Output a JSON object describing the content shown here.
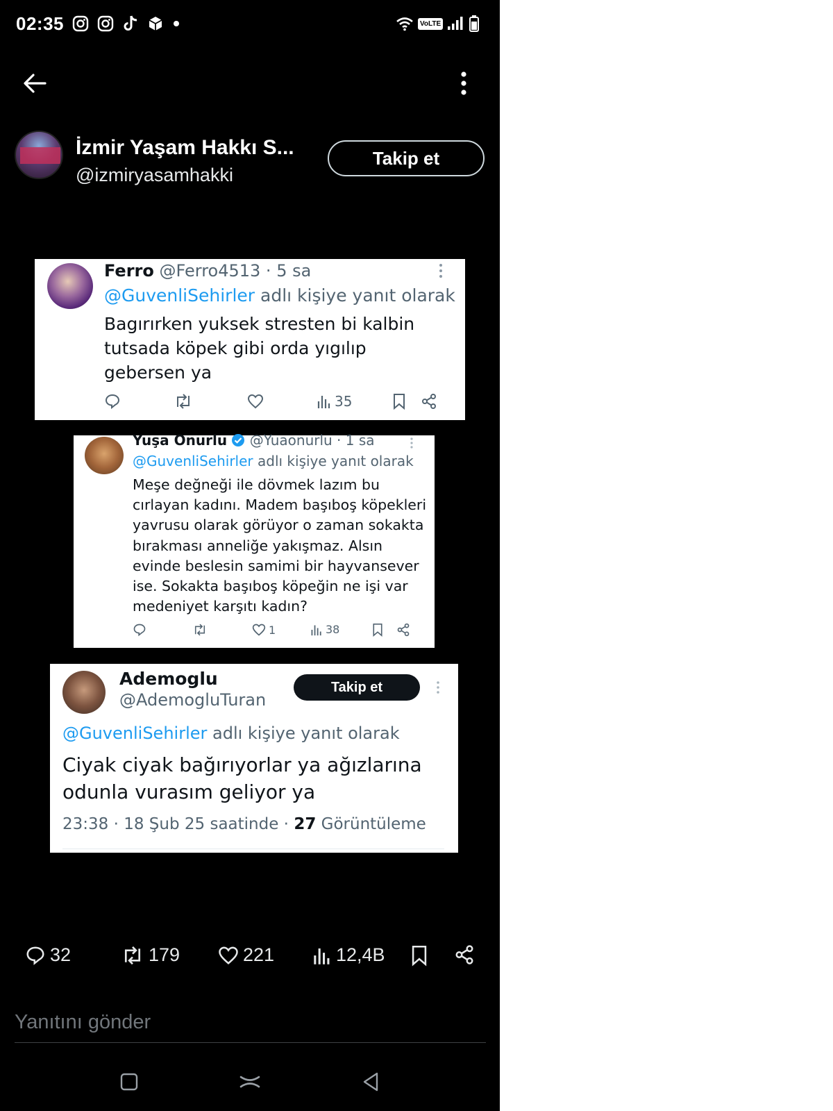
{
  "status_bar": {
    "time": "02:35",
    "notification_icons": [
      "instagram-icon",
      "instagram-icon",
      "tiktok-icon",
      "package-icon",
      "dot-icon"
    ],
    "network_label": "VoLTE"
  },
  "author": {
    "display_name": "İzmir Yaşam Hakkı S...",
    "handle": "@izmiryasamhakki",
    "follow_label": "Takip et"
  },
  "embedded_tweets": [
    {
      "name": "Ferro",
      "handle_time": "@Ferro4513 · 5 sa",
      "reply_mention": "@GuvenliSehirler",
      "reply_suffix": " adlı kişiye yanıt olarak",
      "text": "Bagırırken yuksek stresten bi kalbin tutsada köpek gibi orda yıgılıp gebersen ya",
      "views": "35"
    },
    {
      "name": "Yuşa Onurlu",
      "handle_time": "@Yuaonurlu · 1 sa",
      "reply_mention": "@GuvenliSehirler",
      "reply_suffix": " adlı kişiye yanıt olarak",
      "text": "Meşe değneği ile dövmek lazım bu cırlayan kadını. Madem başıboş köpekleri yavrusu olarak görüyor o zaman sokakta bırakması anneliğe yakışmaz. Alsın evinde beslesin samimi bir hayvansever ise. Sokakta başıboş köpeğin ne işi var medeniyet karşıtı kadın?",
      "likes": "1",
      "views": "38"
    },
    {
      "name": "Ademoglu",
      "handle": "@AdemogluTuran",
      "follow_label": "Takip et",
      "reply_mention": "@GuvenliSehirler",
      "reply_suffix": " adlı kişiye yanıt olarak",
      "text": "Ciyak ciyak bağırıyorlar ya ağızlarına odunla vurasım geliyor ya",
      "meta_time": "23:38 · 18 Şub 25 saatinde · ",
      "meta_views": "27",
      "meta_views_label": " Görüntüleme"
    }
  ],
  "stats": {
    "replies": "32",
    "reposts": "179",
    "likes": "221",
    "views": "12,4B"
  },
  "reply_box": {
    "placeholder": "Yanıtını gönder"
  },
  "colors": {
    "background": "#000000",
    "mention": "#1d9bf0",
    "muted": "#536471"
  }
}
